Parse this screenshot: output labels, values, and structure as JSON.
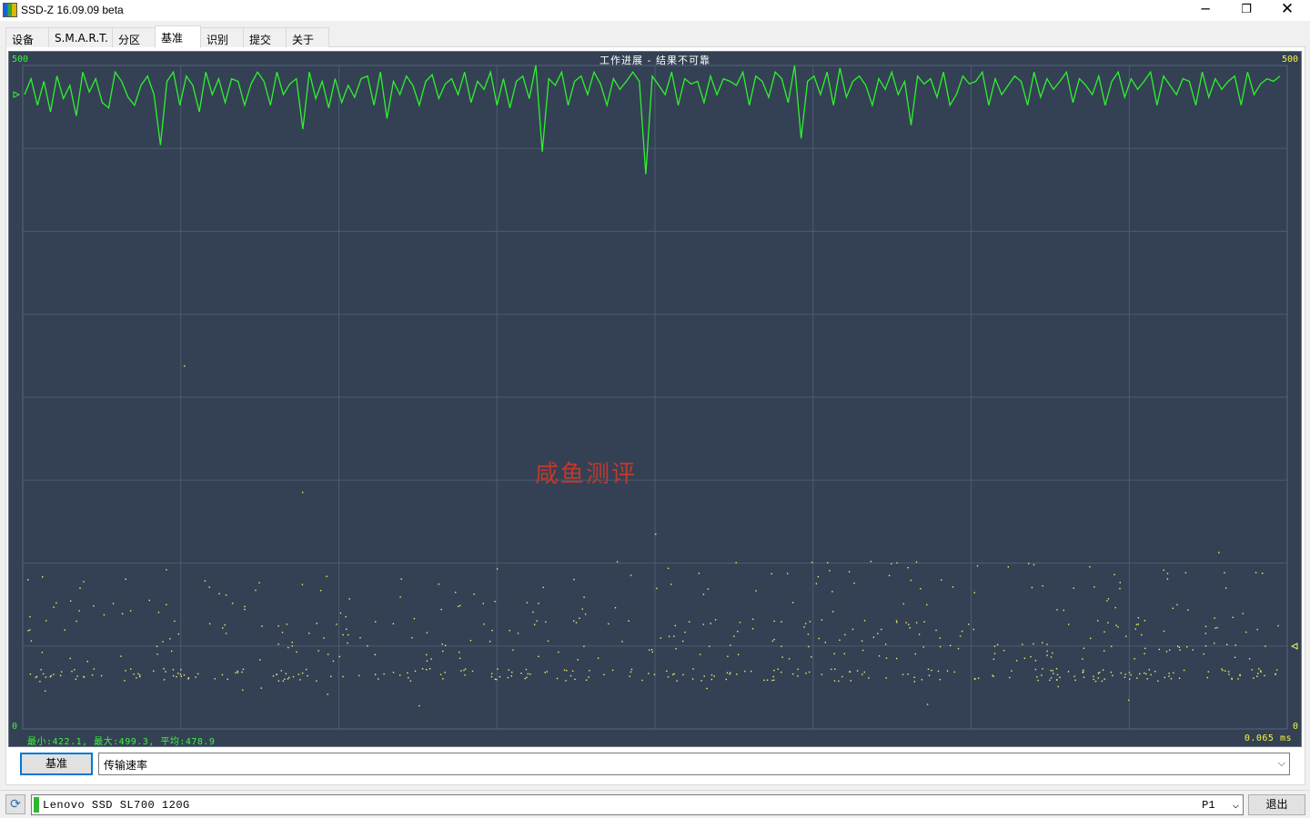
{
  "window": {
    "title": "SSD-Z 16.09.09 beta",
    "controls": {
      "minimize": "─",
      "maximize": "❐",
      "close": "✕"
    }
  },
  "tabs": [
    {
      "label": "设备",
      "active": false
    },
    {
      "label": "S.M.A.R.T.",
      "active": false
    },
    {
      "label": "分区",
      "active": false
    },
    {
      "label": "基准",
      "active": true
    },
    {
      "label": "识别",
      "active": false
    },
    {
      "label": "提交",
      "active": false
    },
    {
      "label": "关于",
      "active": false
    }
  ],
  "chart": {
    "title": "工作进展 - 结果不可靠",
    "y_max_left": "500",
    "y_max_right": "500",
    "y_min_left": "0",
    "y_min_right": "0",
    "stats": "最小:422.1, 最大:499.3, 平均:478.9",
    "latency": "0.065 ms",
    "watermark": "咸鱼测评",
    "colors": {
      "background": "#344154",
      "throughput": "#2ef22e",
      "latency": "#f0f060",
      "grid": "#4b5a6e"
    }
  },
  "chart_data": {
    "type": "line",
    "title": "工作进展 - 结果不可靠",
    "ylim": [
      0,
      500
    ],
    "grid": true,
    "series": [
      {
        "axis": "left",
        "color": "#2ef22e",
        "values": [
          478,
          490,
          470,
          488,
          465,
          492,
          475,
          485,
          462,
          495,
          480,
          490,
          472,
          468,
          495,
          488,
          476,
          470,
          485,
          492,
          478,
          440,
          488,
          495,
          470,
          492,
          485,
          465,
          495,
          478,
          490,
          472,
          490,
          488,
          470,
          486,
          495,
          488,
          470,
          495,
          478,
          486,
          490,
          452,
          495,
          475,
          488,
          468,
          490,
          472,
          485,
          476,
          490,
          492,
          470,
          495,
          460,
          488,
          478,
          492,
          485,
          470,
          488,
          493,
          475,
          486,
          490,
          478,
          495,
          472,
          488,
          482,
          495,
          470,
          490,
          468,
          488,
          492,
          475,
          500,
          435,
          490,
          485,
          495,
          470,
          488,
          492,
          478,
          495,
          486,
          470,
          490,
          482,
          488,
          495,
          488,
          470,
          492,
          485,
          478,
          495,
          470,
          490,
          486,
          488,
          472,
          492,
          478,
          490,
          488,
          485,
          495,
          470,
          492,
          488,
          476,
          495,
          490,
          472,
          500,
          445,
          488,
          492,
          478,
          495,
          470,
          498,
          476,
          488,
          492,
          485,
          470,
          490,
          482,
          495,
          478,
          488,
          455,
          492,
          486,
          490,
          476,
          495,
          470,
          478,
          492,
          486,
          488,
          495,
          470,
          490,
          478,
          485,
          492,
          488,
          470,
          495,
          476,
          490,
          482,
          488,
          495,
          472,
          490,
          485,
          478,
          492,
          470,
          488,
          495,
          476,
          490,
          482,
          488,
          495,
          470,
          492,
          485,
          478,
          490,
          488,
          470,
          495,
          476,
          490,
          482,
          488,
          492,
          470,
          495,
          478,
          486,
          490,
          488,
          492
        ]
      }
    ],
    "dip": {
      "index": 96,
      "value": 418
    }
  },
  "controls": {
    "bench_button": "基准",
    "metric_select": "传输速率",
    "metric_arrow": "⌵"
  },
  "statusbar": {
    "drive_name": "Lenovo SSD SL700 120G",
    "partition": "P1",
    "partition_arrow": "⌵",
    "exit_button": "退出",
    "refresh_icon": "⟳"
  }
}
